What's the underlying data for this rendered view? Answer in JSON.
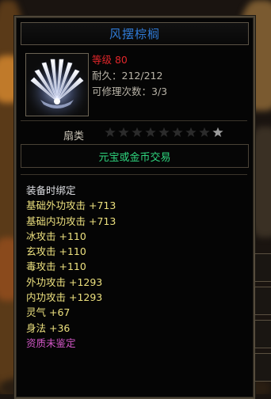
{
  "item": {
    "name": "风摆棕榈",
    "level": "等级 80",
    "durability": "耐久：212/212",
    "repairs": "可修理次数：3/3",
    "type": "扇类",
    "star_rating": {
      "filled": 0,
      "total": 9
    },
    "trade": "元宝或金币交易"
  },
  "attributes": [
    {
      "text": "装备时绑定",
      "color": "#dfe0e4"
    },
    {
      "text": "基础外功攻击 +713",
      "color": "#ece07e"
    },
    {
      "text": "基础内功攻击 +713",
      "color": "#ece07e"
    },
    {
      "text": "冰攻击 +110",
      "color": "#ece07e"
    },
    {
      "text": "玄攻击 +110",
      "color": "#ece07e"
    },
    {
      "text": "毒攻击 +110",
      "color": "#ece07e"
    },
    {
      "text": "外功攻击 +1293",
      "color": "#ece07e"
    },
    {
      "text": "内功攻击 +1293",
      "color": "#ece07e"
    },
    {
      "text": "灵气 +67",
      "color": "#ece07e"
    },
    {
      "text": "身法 +36",
      "color": "#ece07e"
    },
    {
      "text": "资质未鉴定",
      "color": "#d457c8"
    }
  ],
  "colors": {
    "title": "#2f7ad6",
    "level": "#e0262a",
    "trade": "#2fd67f",
    "attribute": "#ece07e",
    "bound": "#dfe0e4",
    "unidentified": "#d457c8"
  },
  "icons": [
    "fan-item-icon",
    "rating-star-icon"
  ]
}
